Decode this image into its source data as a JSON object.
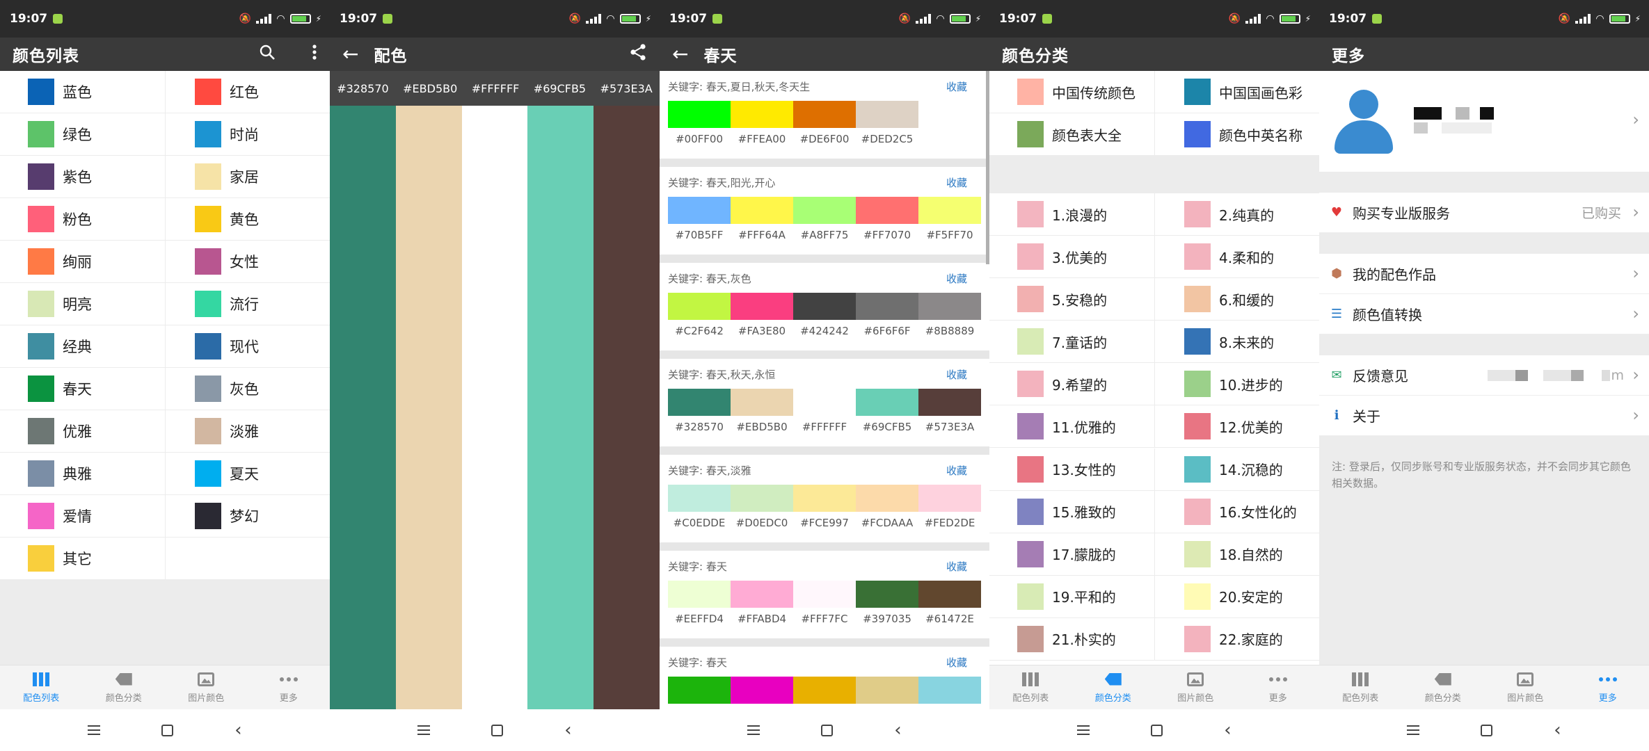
{
  "status": {
    "time": "19:07"
  },
  "nav_tabs": [
    {
      "label": "配色列表",
      "icon": "columns-icon"
    },
    {
      "label": "颜色分类",
      "icon": "tag-icon"
    },
    {
      "label": "图片颜色",
      "icon": "image-icon"
    },
    {
      "label": "更多",
      "icon": "more-dots-icon"
    }
  ],
  "panel1": {
    "title": "颜色列表",
    "items": [
      {
        "label": "蓝色",
        "color": "#0B63B5"
      },
      {
        "label": "红色",
        "color": "#FF4A40"
      },
      {
        "label": "绿色",
        "color": "#5DC369"
      },
      {
        "label": "时尚",
        "color": "#1C94D2"
      },
      {
        "label": "紫色",
        "color": "#573C6E"
      },
      {
        "label": "家居",
        "color": "#F6E3A7"
      },
      {
        "label": "粉色",
        "color": "#FF607A"
      },
      {
        "label": "黄色",
        "color": "#F9C915"
      },
      {
        "label": "绚丽",
        "color": "#FF7A45"
      },
      {
        "label": "女性",
        "color": "#B85690"
      },
      {
        "label": "明亮",
        "color": "#D8E8B5"
      },
      {
        "label": "流行",
        "color": "#34D7A2"
      },
      {
        "label": "经典",
        "color": "#3F8EA1"
      },
      {
        "label": "现代",
        "color": "#2B6BA7"
      },
      {
        "label": "春天",
        "color": "#0B9340"
      },
      {
        "label": "灰色",
        "color": "#8A98A7"
      },
      {
        "label": "优雅",
        "color": "#6D7774"
      },
      {
        "label": "淡雅",
        "color": "#D2B7A1"
      },
      {
        "label": "典雅",
        "color": "#7B8EA6"
      },
      {
        "label": "夏天",
        "color": "#00AEEF"
      },
      {
        "label": "爱情",
        "color": "#F565C7"
      },
      {
        "label": "梦幻",
        "color": "#2A2933"
      },
      {
        "label": "其它",
        "color": "#F9CF3D"
      }
    ]
  },
  "panel2": {
    "title": "配色",
    "colors": [
      {
        "hex": "#328570",
        "color": "#328570"
      },
      {
        "hex": "#EBD5B0",
        "color": "#EBD5B0"
      },
      {
        "hex": "#FFFFFF",
        "color": "#FFFFFF"
      },
      {
        "hex": "#69CFB5",
        "color": "#69CFB5"
      },
      {
        "hex": "#573E3A",
        "color": "#573E3A"
      }
    ]
  },
  "panel3": {
    "title": "春天",
    "fav_label": "收藏",
    "schemes": [
      {
        "keywords": "关键字: 春天,夏日,秋天,冬天生",
        "colors": [
          "#00FF00",
          "#FFEA00",
          "#DE6F00",
          "#DED2C5"
        ]
      },
      {
        "keywords": "关键字: 春天,阳光,开心",
        "colors": [
          "#70B5FF",
          "#FFF64A",
          "#A8FF75",
          "#FF7070",
          "#F5FF70"
        ]
      },
      {
        "keywords": "关键字: 春天,灰色",
        "colors": [
          "#C2F642",
          "#FA3E80",
          "#424242",
          "#6F6F6F",
          "#8B8889"
        ]
      },
      {
        "keywords": "关键字: 春天,秋天,永恒",
        "colors": [
          "#328570",
          "#EBD5B0",
          "#FFFFFF",
          "#69CFB5",
          "#573E3A"
        ]
      },
      {
        "keywords": "关键字: 春天,淡雅",
        "colors": [
          "#C0EDDE",
          "#D0EDC0",
          "#FCE997",
          "#FCDAAA",
          "#FED2DE"
        ]
      },
      {
        "keywords": "关键字: 春天",
        "colors": [
          "#EEFFD4",
          "#FFABD4",
          "#FFF7FC",
          "#397035",
          "#61472E"
        ]
      },
      {
        "keywords": "关键字: 春天",
        "colors": [
          "#1CB40C",
          "#E800C0",
          "#E8B000",
          "#E0CC88",
          "#88D4E0"
        ]
      }
    ]
  },
  "panel4": {
    "title": "颜色分类",
    "top": [
      {
        "label": "中国传统颜色",
        "color": "#FFB3A5"
      },
      {
        "label": "中国国画色彩",
        "color": "#1C85A9"
      },
      {
        "label": "颜色表大全",
        "color": "#7BA95A"
      },
      {
        "label": "颜色中英名称",
        "color": "#4169E1"
      }
    ],
    "items": [
      {
        "label": "1.浪漫的",
        "color": "#F3B5C0"
      },
      {
        "label": "2.纯真的",
        "color": "#F3B3BE"
      },
      {
        "label": "3.优美的",
        "color": "#F3B3BE"
      },
      {
        "label": "4.柔和的",
        "color": "#F3B3BE"
      },
      {
        "label": "5.安稳的",
        "color": "#F2B0B0"
      },
      {
        "label": "6.和缓的",
        "color": "#F2C5A3"
      },
      {
        "label": "7.童话的",
        "color": "#D8EBB5"
      },
      {
        "label": "8.未来的",
        "color": "#3473B5"
      },
      {
        "label": "9.希望的",
        "color": "#F3B3BE"
      },
      {
        "label": "10.进步的",
        "color": "#9BD08A"
      },
      {
        "label": "11.优雅的",
        "color": "#A57DB4"
      },
      {
        "label": "12.优美的",
        "color": "#E87583"
      },
      {
        "label": "13.女性的",
        "color": "#E87583"
      },
      {
        "label": "14.沉稳的",
        "color": "#5BBDC4"
      },
      {
        "label": "15.雅致的",
        "color": "#7F83C1"
      },
      {
        "label": "16.女性化的",
        "color": "#F3B3BE"
      },
      {
        "label": "17.朦胧的",
        "color": "#A57DB4"
      },
      {
        "label": "18.自然的",
        "color": "#DDEAB4"
      },
      {
        "label": "19.平和的",
        "color": "#D8EBB5"
      },
      {
        "label": "20.安定的",
        "color": "#FFFBB5"
      },
      {
        "label": "21.朴实的",
        "color": "#C69B93"
      },
      {
        "label": "22.家庭的",
        "color": "#F3B3BE"
      }
    ]
  },
  "panel5": {
    "title": "更多",
    "buy_label": "购买专业版服务",
    "buy_value": "已购买",
    "works_label": "我的配色作品",
    "convert_label": "颜色值转换",
    "feedback_label": "反馈意见",
    "feedback_tail": "m",
    "about_label": "关于",
    "note": "注: 登录后，仅同步账号和专业版服务状态，并不会同步其它颜色相关数据。"
  }
}
